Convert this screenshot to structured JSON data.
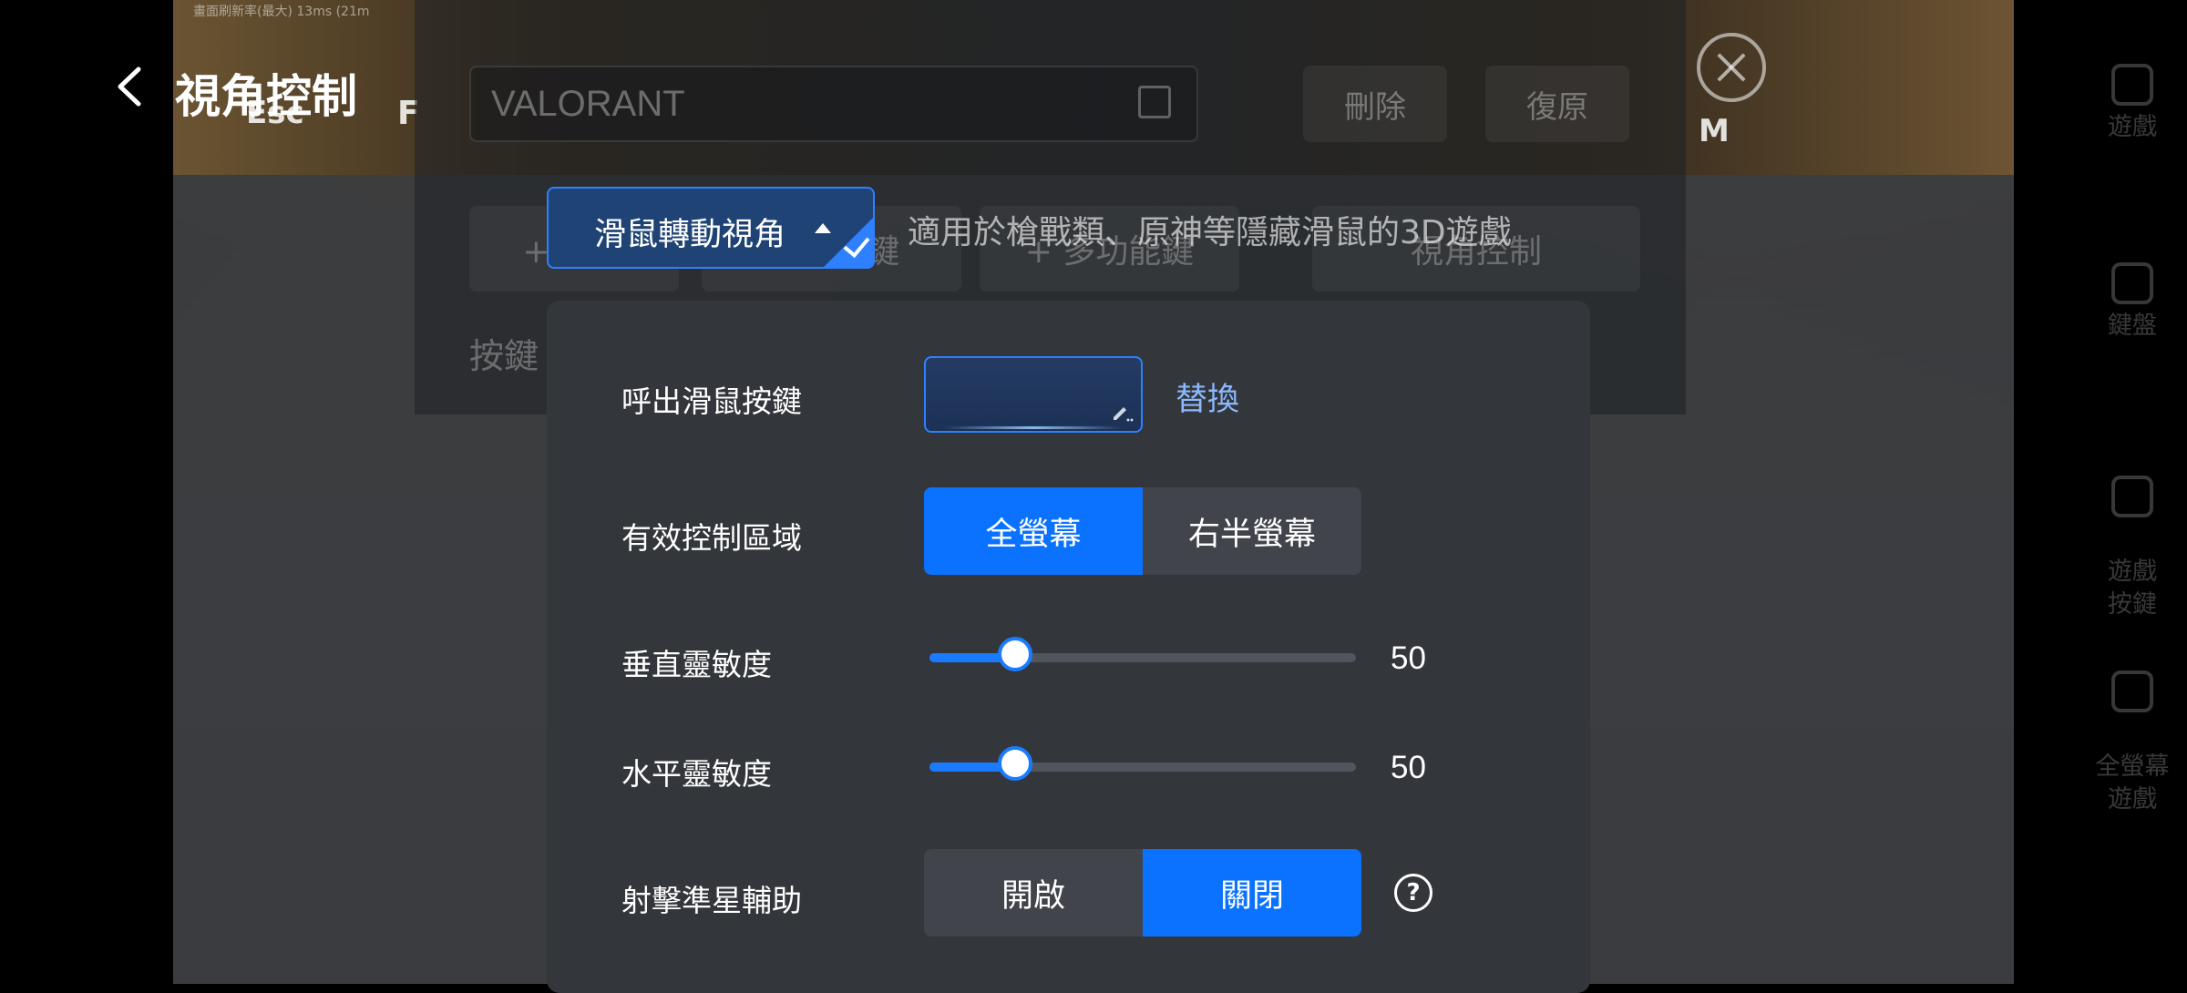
{
  "header": {
    "title": "視角控制"
  },
  "background": {
    "game_name_value": "VALORANT",
    "delete_label": "刪除",
    "restore_label": "復原",
    "tab_labels": [
      "+ 按鍵",
      "+ 組合鍵",
      "+ 多功能鍵",
      "視角控制"
    ],
    "section_label": "按鍵",
    "hud_keys": [
      "Esc",
      "F",
      "M"
    ],
    "hud_status": "畫面刷新率(最大) 13ms (21m"
  },
  "right_rail": {
    "items": [
      {
        "icon": "gamepad-icon",
        "label": "遊戲"
      },
      {
        "icon": "keyboard-icon",
        "label": "鍵盤"
      },
      {
        "icon": "dpad-icon",
        "label": "遊戲\n按鍵"
      },
      {
        "icon": "fullscreen-icon",
        "label": "全螢幕\n遊戲"
      }
    ]
  },
  "mode": {
    "label": "滑鼠轉動視角",
    "description": "適用於槍戰類、原神等隱藏滑鼠的3D遊戲"
  },
  "settings": {
    "call_mouse_key": {
      "label": "呼出滑鼠按鍵",
      "value": "",
      "replace_label": "替換"
    },
    "control_area": {
      "label": "有效控制區域",
      "options": [
        "全螢幕",
        "右半螢幕"
      ],
      "selected": "全螢幕"
    },
    "vertical_sensitivity": {
      "label": "垂直靈敏度",
      "value": 50,
      "display": "50"
    },
    "horizontal_sensitivity": {
      "label": "水平靈敏度",
      "value": 50,
      "display": "50"
    },
    "aim_assist": {
      "label": "射擊準星輔助",
      "options": [
        "開啟",
        "關閉"
      ],
      "selected": "關閉",
      "help_glyph": "?"
    }
  },
  "colors": {
    "accent": "#0a72ff",
    "card": "#33363b",
    "link": "#8bb8ff"
  }
}
